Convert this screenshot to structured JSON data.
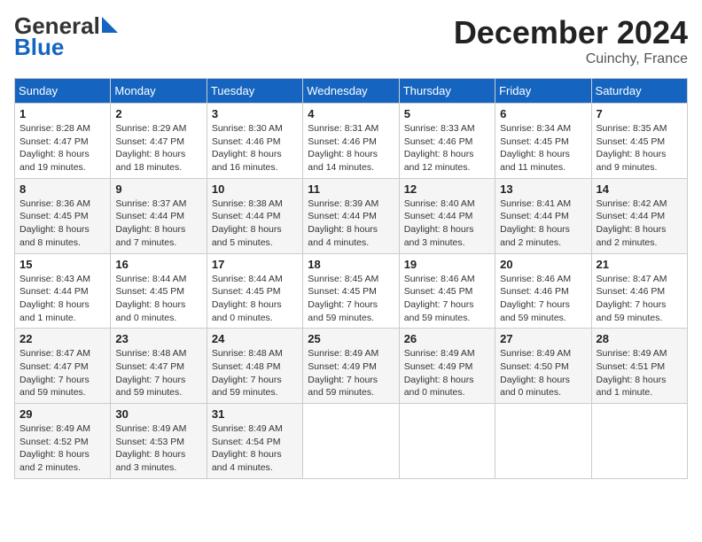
{
  "header": {
    "logo_general": "General",
    "logo_blue": "Blue",
    "month": "December 2024",
    "location": "Cuinchy, France"
  },
  "days_of_week": [
    "Sunday",
    "Monday",
    "Tuesday",
    "Wednesday",
    "Thursday",
    "Friday",
    "Saturday"
  ],
  "weeks": [
    [
      {
        "day": "1",
        "info": "Sunrise: 8:28 AM\nSunset: 4:47 PM\nDaylight: 8 hours and 19 minutes."
      },
      {
        "day": "2",
        "info": "Sunrise: 8:29 AM\nSunset: 4:47 PM\nDaylight: 8 hours and 18 minutes."
      },
      {
        "day": "3",
        "info": "Sunrise: 8:30 AM\nSunset: 4:46 PM\nDaylight: 8 hours and 16 minutes."
      },
      {
        "day": "4",
        "info": "Sunrise: 8:31 AM\nSunset: 4:46 PM\nDaylight: 8 hours and 14 minutes."
      },
      {
        "day": "5",
        "info": "Sunrise: 8:33 AM\nSunset: 4:46 PM\nDaylight: 8 hours and 12 minutes."
      },
      {
        "day": "6",
        "info": "Sunrise: 8:34 AM\nSunset: 4:45 PM\nDaylight: 8 hours and 11 minutes."
      },
      {
        "day": "7",
        "info": "Sunrise: 8:35 AM\nSunset: 4:45 PM\nDaylight: 8 hours and 9 minutes."
      }
    ],
    [
      {
        "day": "8",
        "info": "Sunrise: 8:36 AM\nSunset: 4:45 PM\nDaylight: 8 hours and 8 minutes."
      },
      {
        "day": "9",
        "info": "Sunrise: 8:37 AM\nSunset: 4:44 PM\nDaylight: 8 hours and 7 minutes."
      },
      {
        "day": "10",
        "info": "Sunrise: 8:38 AM\nSunset: 4:44 PM\nDaylight: 8 hours and 5 minutes."
      },
      {
        "day": "11",
        "info": "Sunrise: 8:39 AM\nSunset: 4:44 PM\nDaylight: 8 hours and 4 minutes."
      },
      {
        "day": "12",
        "info": "Sunrise: 8:40 AM\nSunset: 4:44 PM\nDaylight: 8 hours and 3 minutes."
      },
      {
        "day": "13",
        "info": "Sunrise: 8:41 AM\nSunset: 4:44 PM\nDaylight: 8 hours and 2 minutes."
      },
      {
        "day": "14",
        "info": "Sunrise: 8:42 AM\nSunset: 4:44 PM\nDaylight: 8 hours and 2 minutes."
      }
    ],
    [
      {
        "day": "15",
        "info": "Sunrise: 8:43 AM\nSunset: 4:44 PM\nDaylight: 8 hours and 1 minute."
      },
      {
        "day": "16",
        "info": "Sunrise: 8:44 AM\nSunset: 4:45 PM\nDaylight: 8 hours and 0 minutes."
      },
      {
        "day": "17",
        "info": "Sunrise: 8:44 AM\nSunset: 4:45 PM\nDaylight: 8 hours and 0 minutes."
      },
      {
        "day": "18",
        "info": "Sunrise: 8:45 AM\nSunset: 4:45 PM\nDaylight: 7 hours and 59 minutes."
      },
      {
        "day": "19",
        "info": "Sunrise: 8:46 AM\nSunset: 4:45 PM\nDaylight: 7 hours and 59 minutes."
      },
      {
        "day": "20",
        "info": "Sunrise: 8:46 AM\nSunset: 4:46 PM\nDaylight: 7 hours and 59 minutes."
      },
      {
        "day": "21",
        "info": "Sunrise: 8:47 AM\nSunset: 4:46 PM\nDaylight: 7 hours and 59 minutes."
      }
    ],
    [
      {
        "day": "22",
        "info": "Sunrise: 8:47 AM\nSunset: 4:47 PM\nDaylight: 7 hours and 59 minutes."
      },
      {
        "day": "23",
        "info": "Sunrise: 8:48 AM\nSunset: 4:47 PM\nDaylight: 7 hours and 59 minutes."
      },
      {
        "day": "24",
        "info": "Sunrise: 8:48 AM\nSunset: 4:48 PM\nDaylight: 7 hours and 59 minutes."
      },
      {
        "day": "25",
        "info": "Sunrise: 8:49 AM\nSunset: 4:49 PM\nDaylight: 7 hours and 59 minutes."
      },
      {
        "day": "26",
        "info": "Sunrise: 8:49 AM\nSunset: 4:49 PM\nDaylight: 8 hours and 0 minutes."
      },
      {
        "day": "27",
        "info": "Sunrise: 8:49 AM\nSunset: 4:50 PM\nDaylight: 8 hours and 0 minutes."
      },
      {
        "day": "28",
        "info": "Sunrise: 8:49 AM\nSunset: 4:51 PM\nDaylight: 8 hours and 1 minute."
      }
    ],
    [
      {
        "day": "29",
        "info": "Sunrise: 8:49 AM\nSunset: 4:52 PM\nDaylight: 8 hours and 2 minutes."
      },
      {
        "day": "30",
        "info": "Sunrise: 8:49 AM\nSunset: 4:53 PM\nDaylight: 8 hours and 3 minutes."
      },
      {
        "day": "31",
        "info": "Sunrise: 8:49 AM\nSunset: 4:54 PM\nDaylight: 8 hours and 4 minutes."
      },
      null,
      null,
      null,
      null
    ]
  ]
}
